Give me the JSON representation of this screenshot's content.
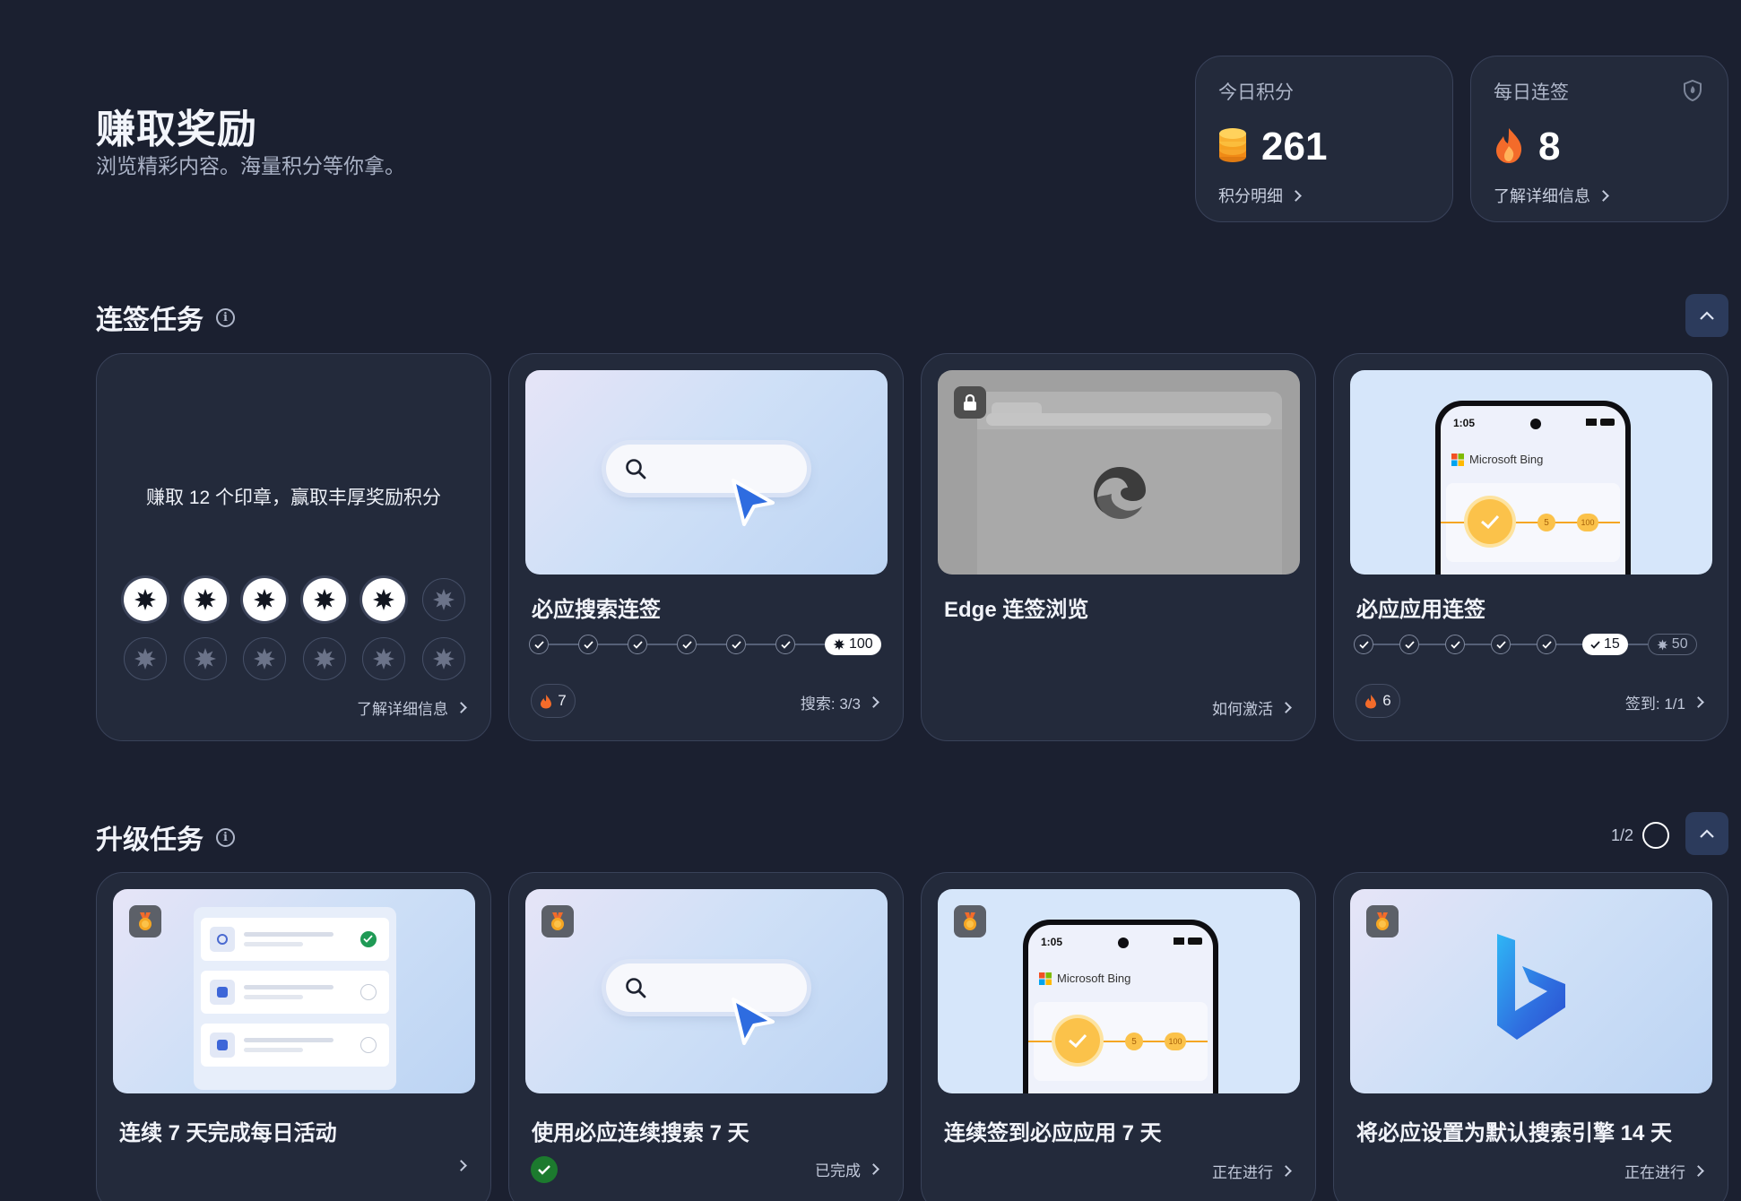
{
  "header": {
    "title": "赚取奖励",
    "subtitle": "浏览精彩内容。海量积分等你拿。"
  },
  "stats": {
    "points": {
      "label": "今日积分",
      "value": "261",
      "link": "积分明细"
    },
    "streak": {
      "label": "每日连签",
      "value": "8",
      "link": "了解详细信息"
    }
  },
  "streak_section": {
    "title": "连签任务",
    "stamps_card": {
      "text": "赚取 12 个印章，赢取丰厚奖励积分",
      "earned": 5,
      "total": 12,
      "link": "了解详细信息"
    },
    "search_card": {
      "title": "必应搜索连签",
      "checks": 6,
      "reward": "100",
      "flame_count": "7",
      "link": "搜索: 3/3"
    },
    "edge_card": {
      "title": "Edge 连签浏览",
      "link": "如何激活"
    },
    "app_card": {
      "title": "必应应用连签",
      "phone_time": "1:05",
      "phone_brand": "Microsoft Bing",
      "coin_small": "5",
      "coin_big": "100",
      "checks": 5,
      "current_reward": "15",
      "next_reward": "50",
      "flame_count": "6",
      "link": "签到: 1/1"
    }
  },
  "upgrade_section": {
    "title": "升级任务",
    "pager": "1/2",
    "cards": [
      {
        "title": "连续 7 天完成每日活动",
        "status": ""
      },
      {
        "title": "使用必应连续搜索 7 天",
        "status": "已完成"
      },
      {
        "title": "连续签到必应应用 7 天",
        "status": "正在进行",
        "phone_time": "1:05",
        "phone_brand": "Microsoft Bing",
        "coin_small": "5",
        "coin_big": "100"
      },
      {
        "title": "将必应设置为默认搜索引擎 14 天",
        "status": "正在进行"
      }
    ]
  },
  "colors": {
    "background": "#1b2030",
    "card": "#232a3b",
    "accent_blue": "#2f6fe0",
    "flame": "#f36b2a",
    "coin": "#f5a623",
    "done_green": "#1c7a2e"
  }
}
